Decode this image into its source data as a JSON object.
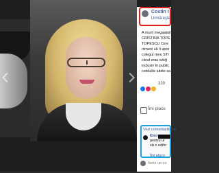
{
  "post": {
    "author_name": "Costin I",
    "follow_label": "Urmăreşte",
    "text_lines": [
      "A murit megaatuil",
      "CRISTINA TOPE",
      "TOPESCU Cine",
      "nimeni să îi apro",
      "colegul meu STI",
      "când erau iubiţi",
      "inclusiv în public",
      "celelalte iubite sa"
    ],
    "reaction_count": "339",
    "like_label": "Îmi place"
  },
  "comments": {
    "title": "Vezi comentariile re",
    "items": [
      {
        "name": "Eleon",
        "text_lines": [
          "pentru ur",
          "să o odihr"
        ],
        "like_label": "Îmi place"
      }
    ],
    "write_placeholder": "Scrie un co"
  },
  "colors": {
    "highlight_red": "#e11d1d",
    "highlight_blue": "#1ba3e6",
    "facebook_blue": "#3b5998"
  },
  "icons": {
    "author_avatar": "avatar",
    "like_reaction": "like-icon",
    "love_reaction": "love-icon",
    "haha_reaction": "haha-icon",
    "thumbs_up": "thumbs-up-icon"
  }
}
